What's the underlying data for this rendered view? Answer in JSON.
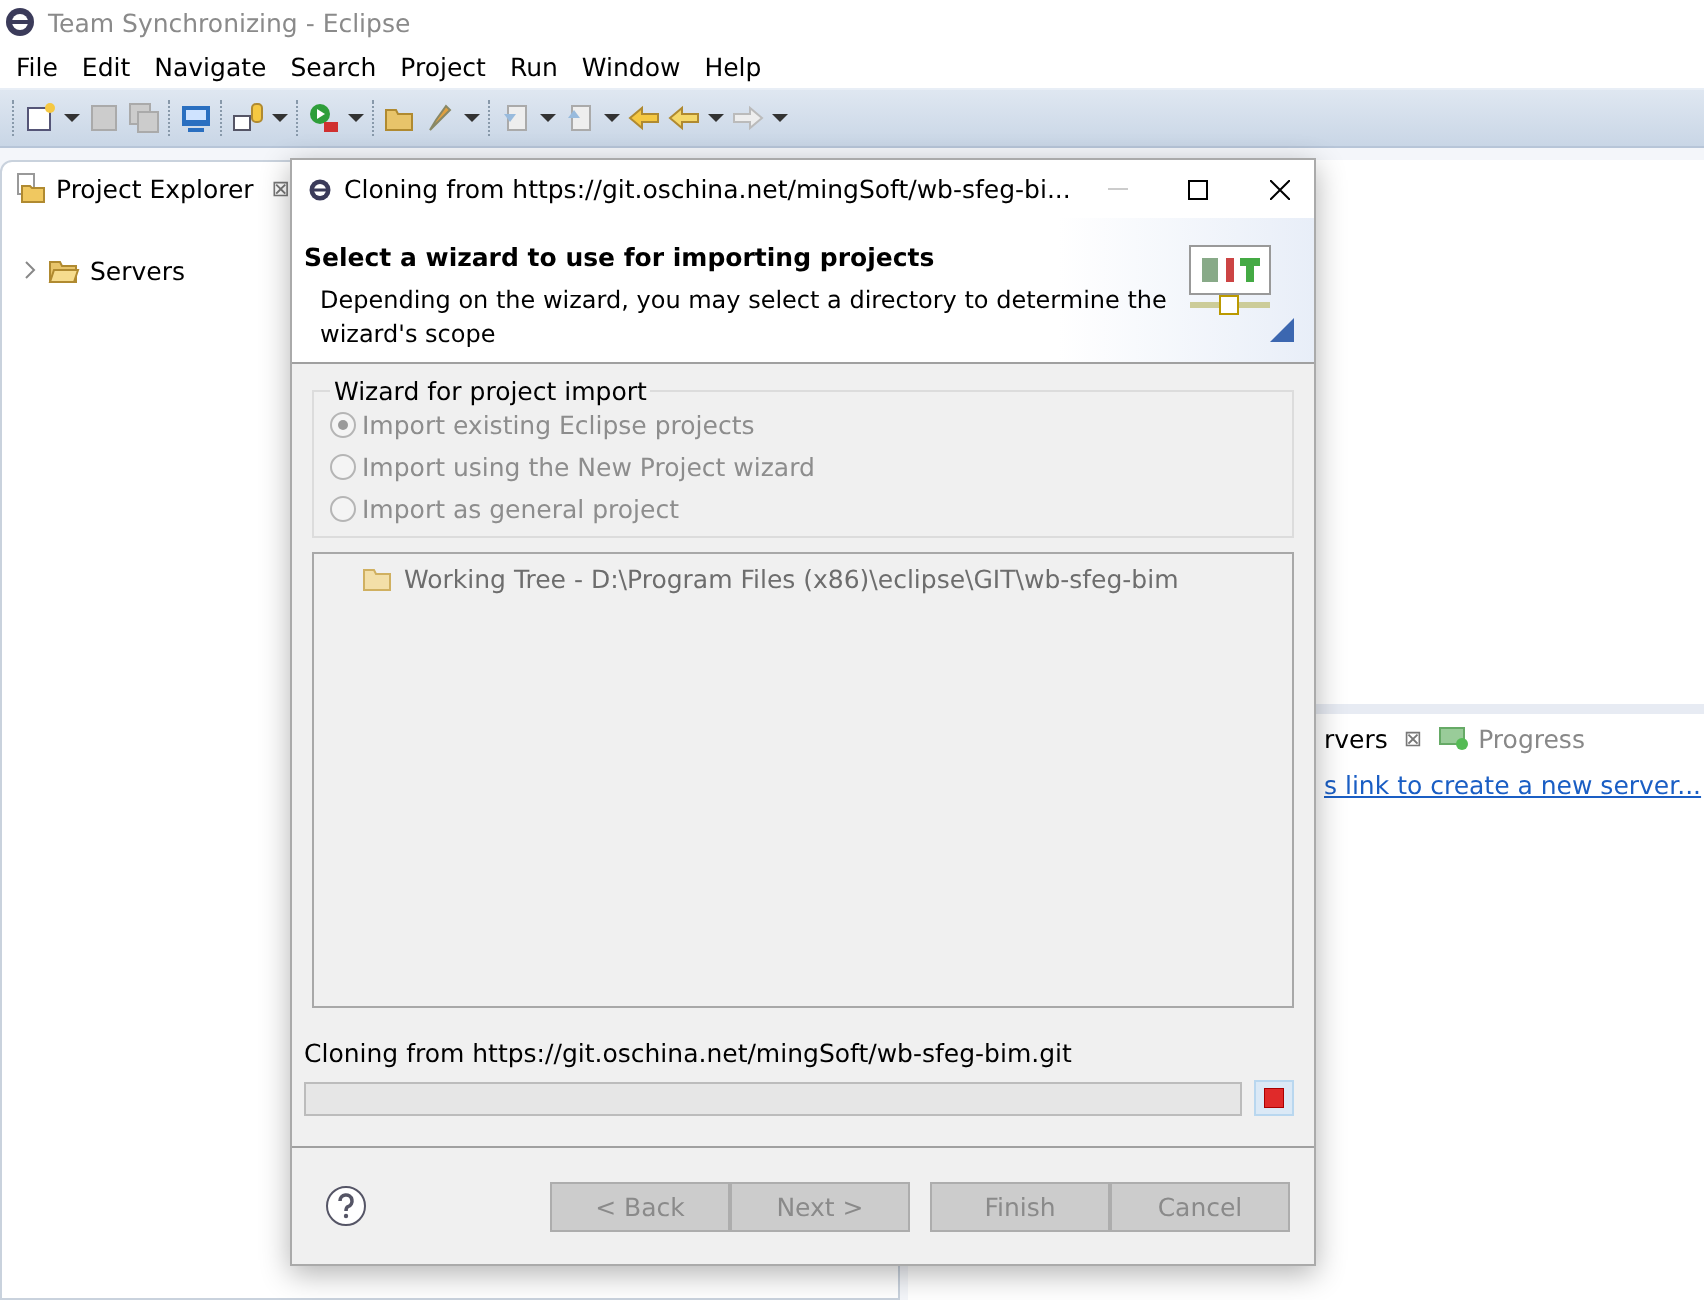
{
  "window": {
    "title": "Team Synchronizing - Eclipse"
  },
  "menu": [
    "File",
    "Edit",
    "Navigate",
    "Search",
    "Project",
    "Run",
    "Window",
    "Help"
  ],
  "project_explorer": {
    "tab": "Project Explorer",
    "close": "⊠",
    "items": [
      {
        "label": "Servers",
        "expanded": false
      }
    ]
  },
  "servers_view": {
    "tabs": [
      {
        "label": "rvers",
        "selected": true,
        "close": "⊠"
      },
      {
        "label": "Progress",
        "selected": false
      }
    ],
    "link": "s link to create a new server..."
  },
  "dialog": {
    "title": "Cloning from https://git.oschina.net/mingSoft/wb-sfeg-bi...",
    "header": {
      "title": "Select a wizard to use for importing projects",
      "description": "Depending on the wizard, you may select a directory to determine the wizard's scope"
    },
    "group": {
      "label": "Wizard for project import",
      "options": [
        {
          "label": "Import existing Eclipse projects",
          "selected": true,
          "disabled": true
        },
        {
          "label": "Import using the New Project wizard",
          "selected": false,
          "disabled": true
        },
        {
          "label": "Import as general project",
          "selected": false,
          "disabled": true
        }
      ]
    },
    "tree": {
      "items": [
        {
          "label": "Working Tree - D:\\Program Files (x86)\\eclipse\\GIT\\wb-sfeg-bim",
          "disabled": true
        }
      ]
    },
    "status": "Cloning from https://git.oschina.net/mingSoft/wb-sfeg-bim.git",
    "progress": {
      "level": 0
    },
    "buttons": [
      {
        "label": "< Back",
        "disabled": true
      },
      {
        "label": "Next >",
        "disabled": true
      },
      {
        "label": "Finish",
        "disabled": true
      },
      {
        "label": "Cancel",
        "disabled": true
      }
    ]
  }
}
